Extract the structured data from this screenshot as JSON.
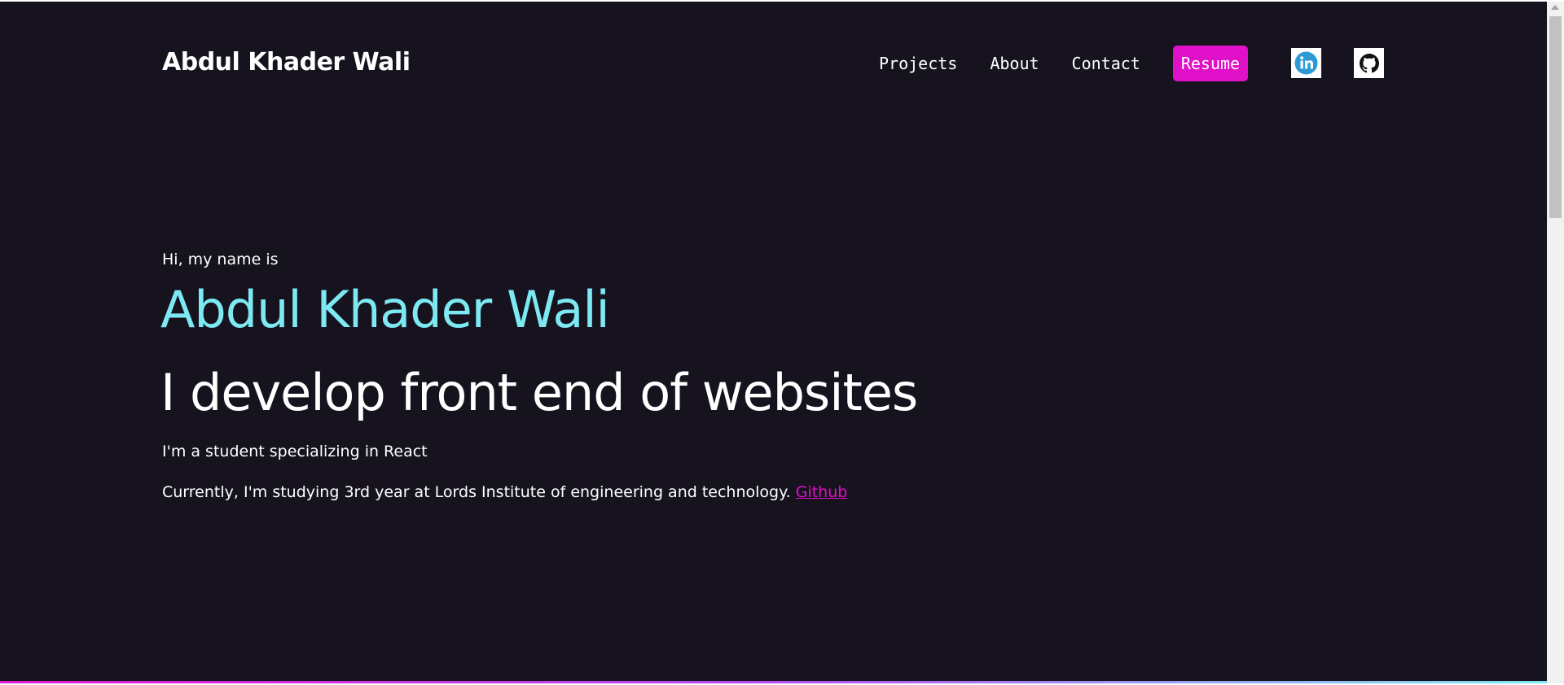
{
  "header": {
    "brand": "Abdul Khader Wali",
    "nav": {
      "projects": "Projects",
      "about": "About",
      "contact": "Contact",
      "resume": "Resume"
    },
    "social": {
      "linkedin_icon": "linkedin-icon",
      "github_icon": "github-icon"
    }
  },
  "hero": {
    "intro": "Hi, my name is",
    "name": "Abdul Khader Wali",
    "tagline": "I develop front end of websites",
    "description": "I'm a student specializing in React",
    "education_text": "Currently, I'm studying 3rd year at Lords Institute of engineering and technology.",
    "github_link": "Github"
  },
  "colors": {
    "background": "#16131f",
    "accent_pink": "#e010c8",
    "accent_cyan": "#7de9f2",
    "text": "#ffffff"
  }
}
